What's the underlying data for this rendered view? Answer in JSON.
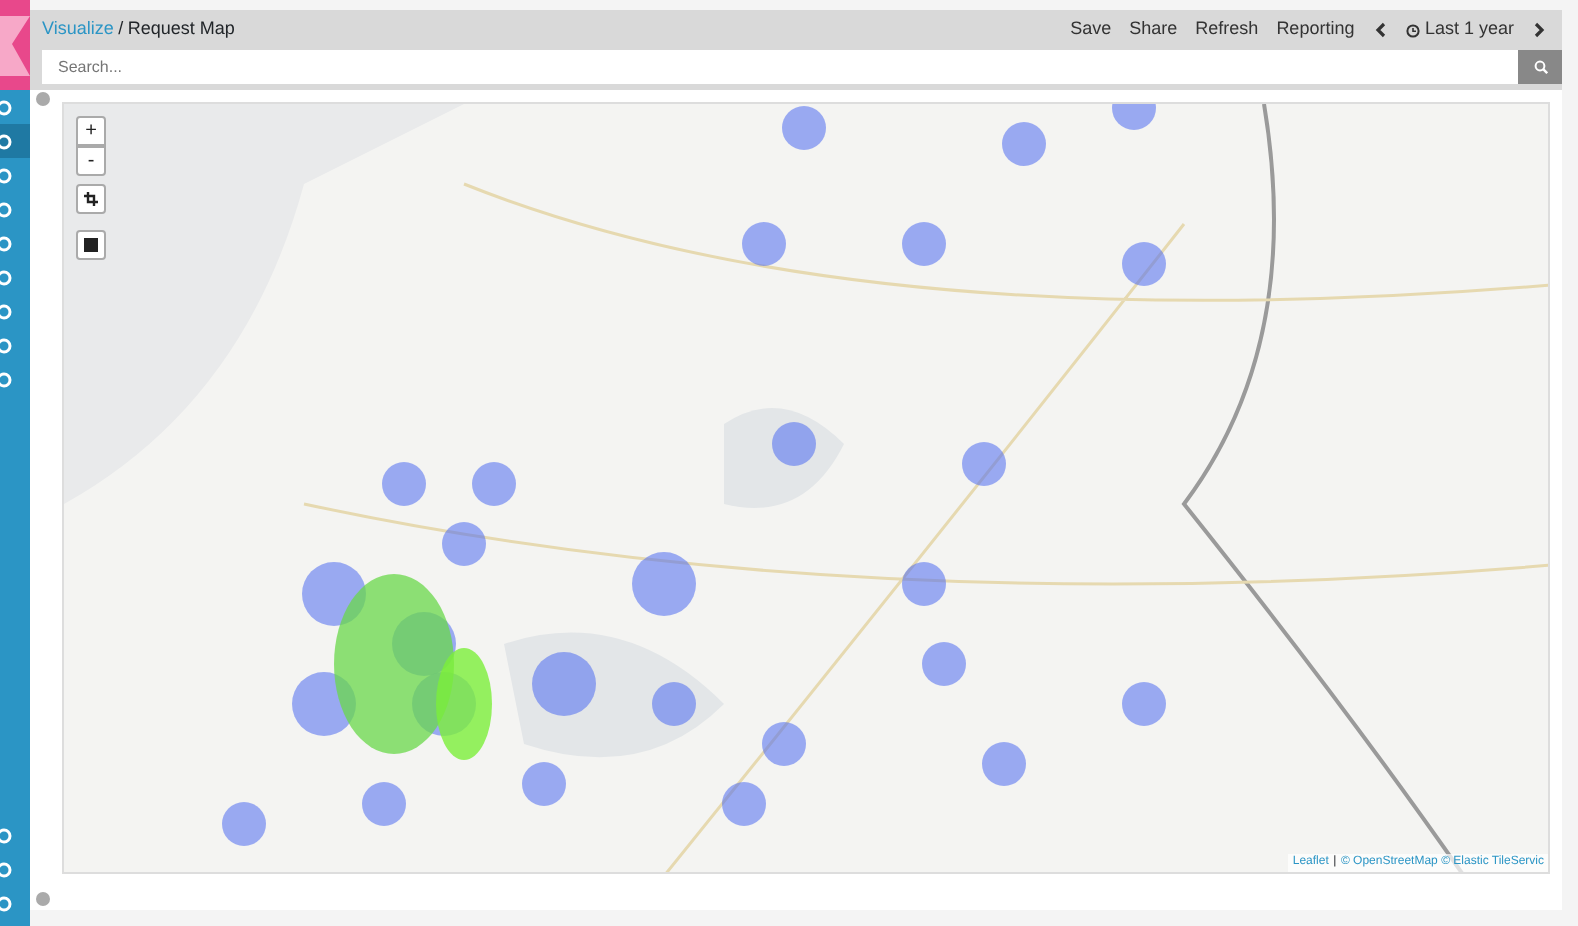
{
  "sidebar": {
    "items": [
      {
        "selected": false
      },
      {
        "selected": true
      },
      {
        "selected": false
      },
      {
        "selected": false
      },
      {
        "selected": false
      },
      {
        "selected": false
      },
      {
        "selected": false
      },
      {
        "selected": false
      },
      {
        "selected": false
      }
    ],
    "bottom_items": [
      {
        "selected": false
      },
      {
        "selected": false
      },
      {
        "selected": false
      }
    ]
  },
  "breadcrumb": [
    {
      "label": "Visualize",
      "kind": "link"
    },
    {
      "label": "Request Map",
      "kind": "current"
    }
  ],
  "breadcrumb_separator": "/",
  "menu": [
    "Save",
    "Share",
    "Refresh",
    "Reporting"
  ],
  "time_range": "Last 1 year",
  "search": {
    "placeholder": "Search..."
  },
  "map": {
    "zoom_in": "+",
    "zoom_out": "-",
    "attribution": [
      "Leaflet",
      "|",
      "© OpenStreetMap © Elastic TileServic"
    ]
  }
}
